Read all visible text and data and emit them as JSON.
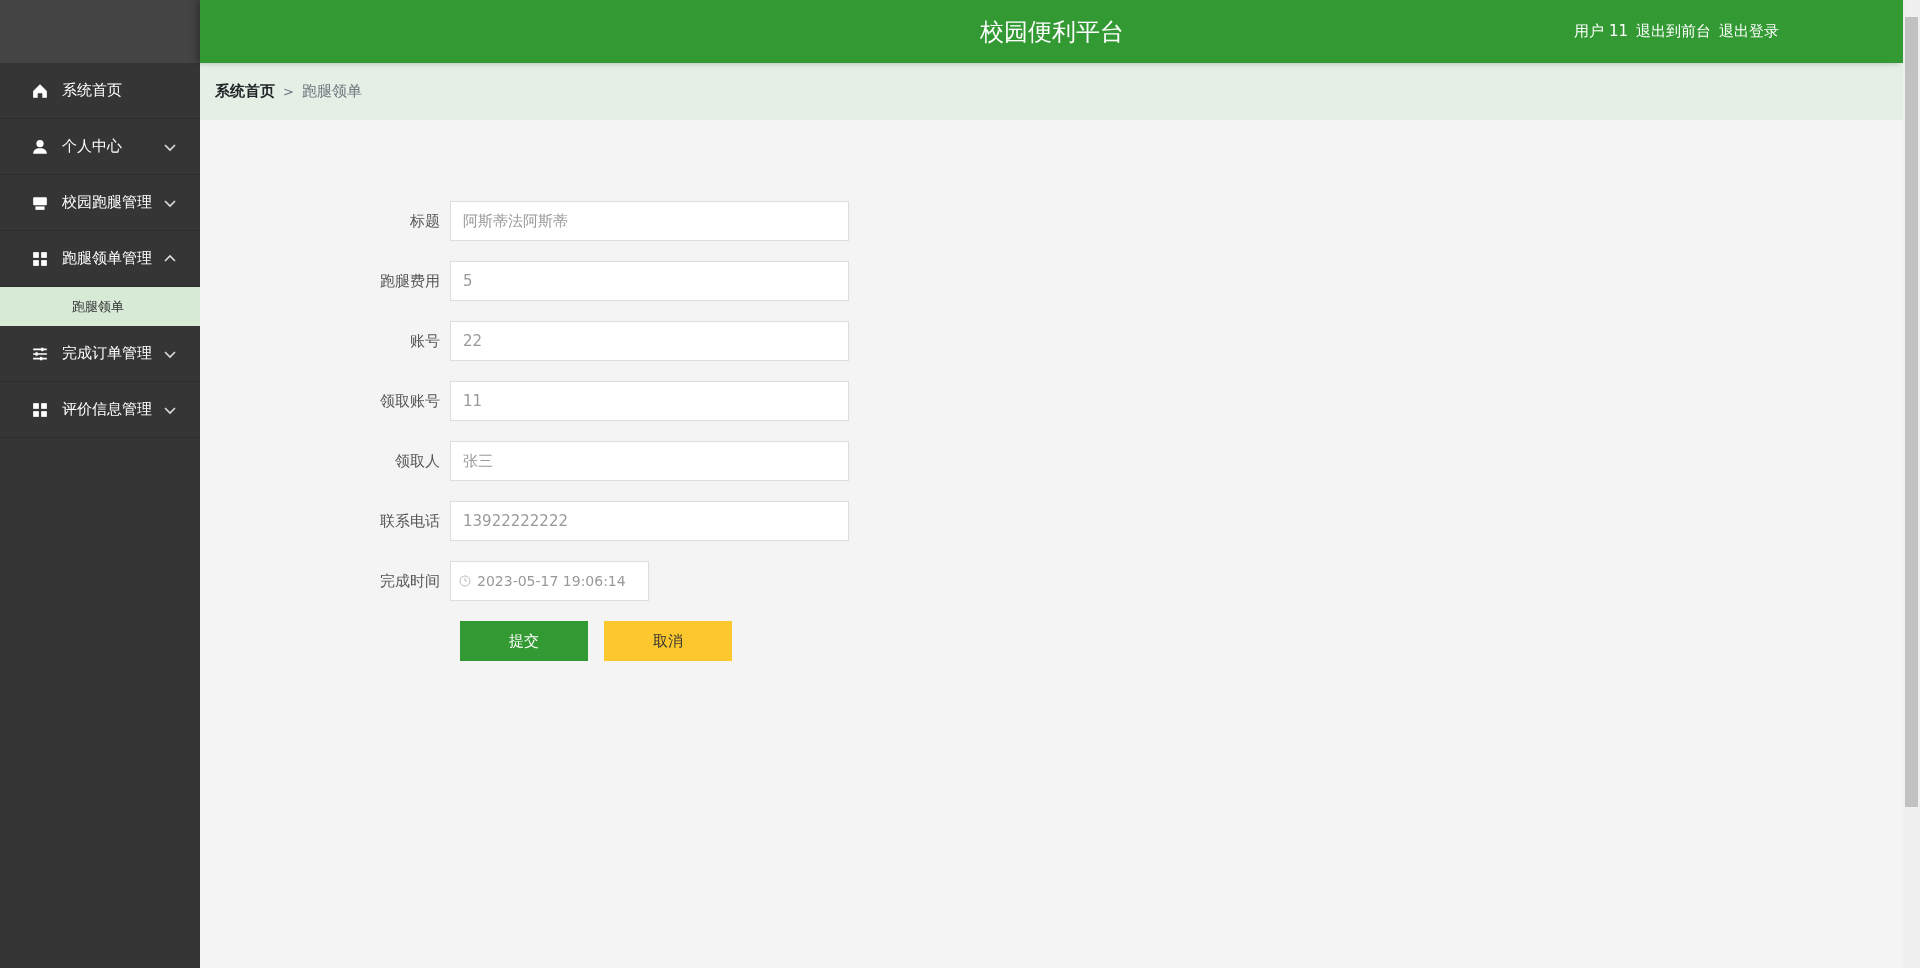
{
  "header": {
    "title": "校园便利平台",
    "user_label": "用户 11",
    "links": [
      "退出到前台",
      "退出登录"
    ]
  },
  "sidebar": {
    "items": [
      {
        "label": "系统首页",
        "kind": "link"
      },
      {
        "label": "个人中心",
        "kind": "menu",
        "expanded": false
      },
      {
        "label": "校园跑腿管理",
        "kind": "menu",
        "expanded": false
      },
      {
        "label": "跑腿领单管理",
        "kind": "menu",
        "expanded": true,
        "children": [
          {
            "label": "跑腿领单",
            "selected": true
          }
        ]
      },
      {
        "label": "完成订单管理",
        "kind": "menu",
        "expanded": false
      },
      {
        "label": "评价信息管理",
        "kind": "menu",
        "expanded": false
      }
    ]
  },
  "breadcrumb": [
    "系统首页",
    "跑腿领单"
  ],
  "breadcrumb_separator": ">",
  "form": {
    "fields": [
      {
        "label": "标题",
        "value": "阿斯蒂法阿斯蒂",
        "kind": "text",
        "disabled": true
      },
      {
        "label": "跑腿费用",
        "value": "5",
        "kind": "text",
        "disabled": true
      },
      {
        "label": "账号",
        "value": "22",
        "kind": "text",
        "disabled": true
      },
      {
        "label": "领取账号",
        "value": "11",
        "kind": "text",
        "disabled": true
      },
      {
        "label": "领取人",
        "value": "张三",
        "kind": "text",
        "disabled": true
      },
      {
        "label": "联系电话",
        "value": "13922222222",
        "kind": "text",
        "disabled": true
      },
      {
        "label": "完成时间",
        "value": "2023-05-17 19:06:14",
        "kind": "datetime",
        "disabled": true
      }
    ],
    "buttons": [
      {
        "label": "提交",
        "kind": "primary"
      },
      {
        "label": "取消",
        "kind": "warning"
      }
    ]
  }
}
